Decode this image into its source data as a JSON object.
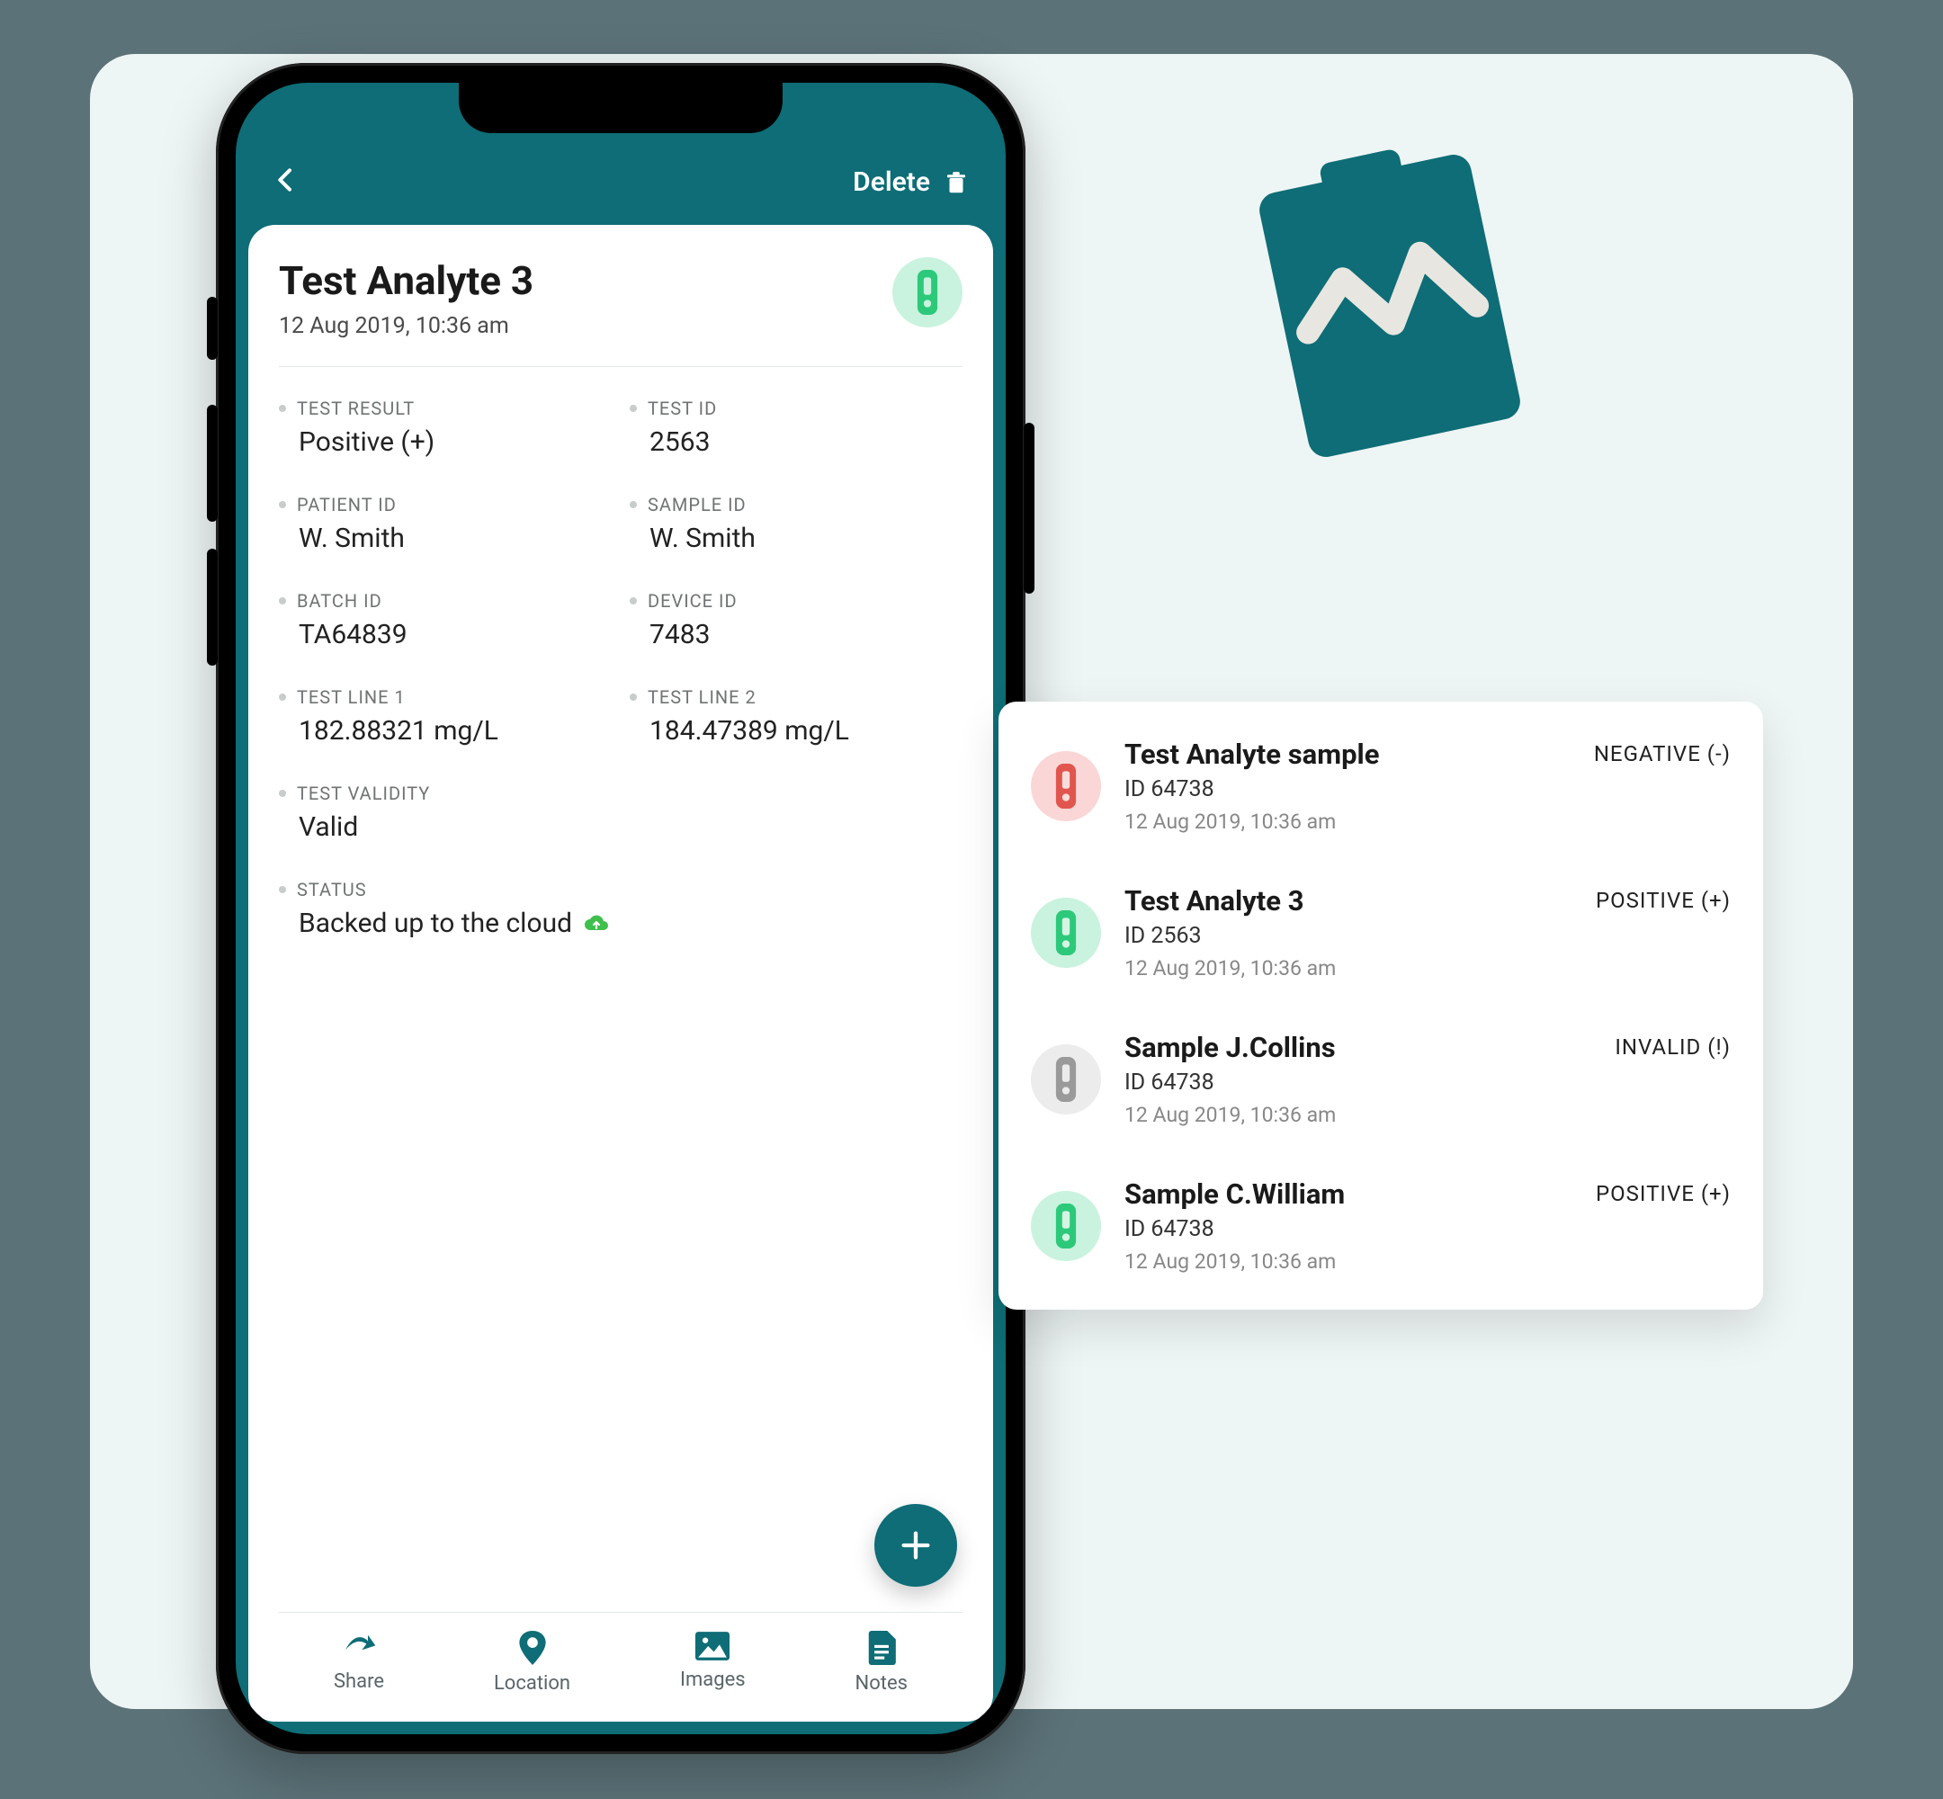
{
  "topbar": {
    "delete_label": "Delete"
  },
  "detail": {
    "title": "Test Analyte 3",
    "timestamp": "12 Aug 2019, 10:36 am",
    "badge_color": "green",
    "fields": {
      "test_result_label": "TEST RESULT",
      "test_result_value": "Positive (+)",
      "test_id_label": "TEST ID",
      "test_id_value": "2563",
      "patient_id_label": "PATIENT ID",
      "patient_id_value": "W. Smith",
      "sample_id_label": "SAMPLE ID",
      "sample_id_value": "W. Smith",
      "batch_id_label": "BATCH ID",
      "batch_id_value": "TA64839",
      "device_id_label": "DEVICE ID",
      "device_id_value": "7483",
      "test_line_1_label": "TEST LINE 1",
      "test_line_1_value": "182.88321 mg/L",
      "test_line_2_label": "TEST LINE 2",
      "test_line_2_value": "184.47389 mg/L",
      "test_validity_label": "TEST VALIDITY",
      "test_validity_value": "Valid",
      "status_label": "STATUS",
      "status_value": "Backed up to the cloud"
    }
  },
  "nav": {
    "share": "Share",
    "location": "Location",
    "images": "Images",
    "notes": "Notes"
  },
  "list": [
    {
      "title": "Test Analyte sample",
      "id": "ID 64738",
      "time": "12 Aug 2019, 10:36 am",
      "status": "NEGATIVE (-)",
      "color": "red"
    },
    {
      "title": "Test Analyte 3",
      "id": "ID 2563",
      "time": "12 Aug 2019, 10:36 am",
      "status": "POSITIVE (+)",
      "color": "green"
    },
    {
      "title": "Sample J.Collins",
      "id": "ID 64738",
      "time": "12 Aug 2019, 10:36 am",
      "status": "INVALID (!)",
      "color": "gray"
    },
    {
      "title": "Sample C.William",
      "id": "ID 64738",
      "time": "12 Aug 2019, 10:36 am",
      "status": "POSITIVE (+)",
      "color": "green"
    }
  ],
  "icons": {
    "vial_green": "#2dc97a",
    "vial_red": "#e0564e",
    "vial_gray": "#9a9a9a"
  }
}
